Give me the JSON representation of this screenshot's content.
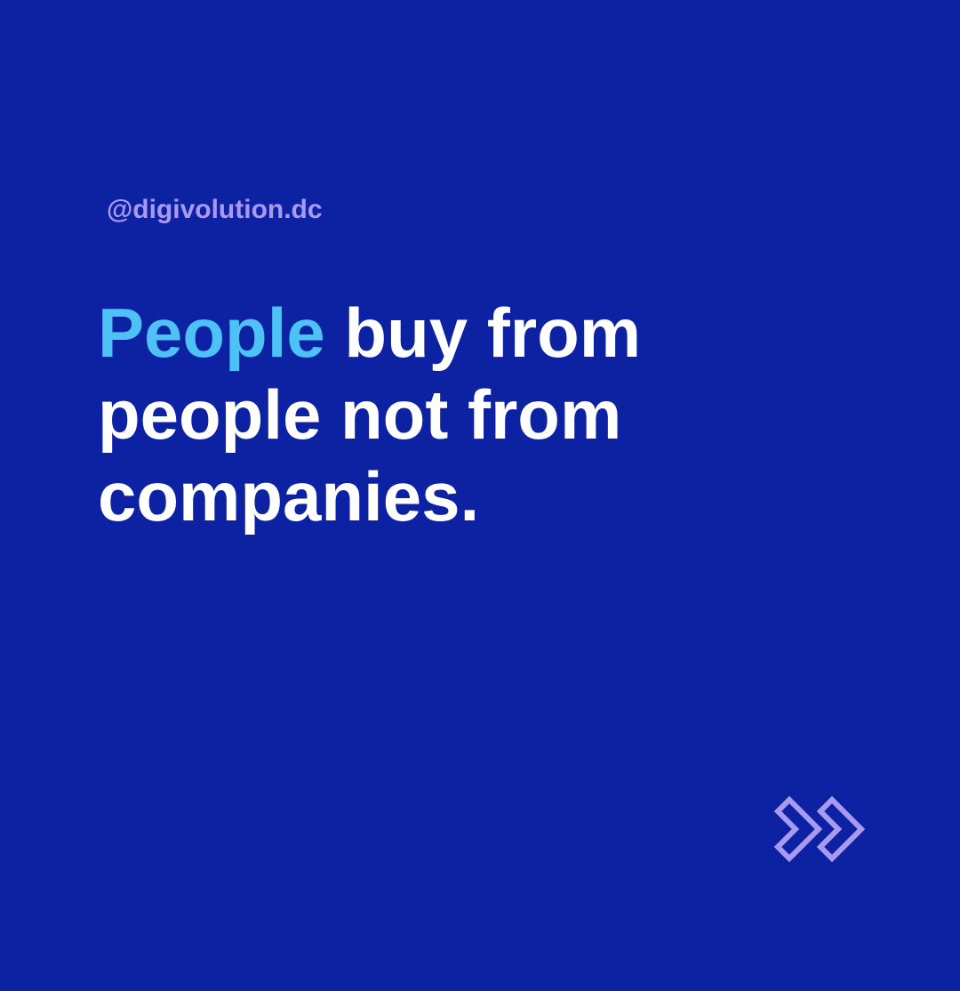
{
  "handle": "@digivolution.dc",
  "headline": {
    "accent_word": "People",
    "line1_rest": " buy from",
    "line2": "people not from",
    "line3": "companies."
  },
  "colors": {
    "background": "#0c22a3",
    "accent": "#4ec2f7",
    "handle": "#a89af0",
    "arrow": "#a89af0",
    "text": "#ffffff"
  },
  "icons": {
    "next": "double-chevron-right-icon"
  }
}
